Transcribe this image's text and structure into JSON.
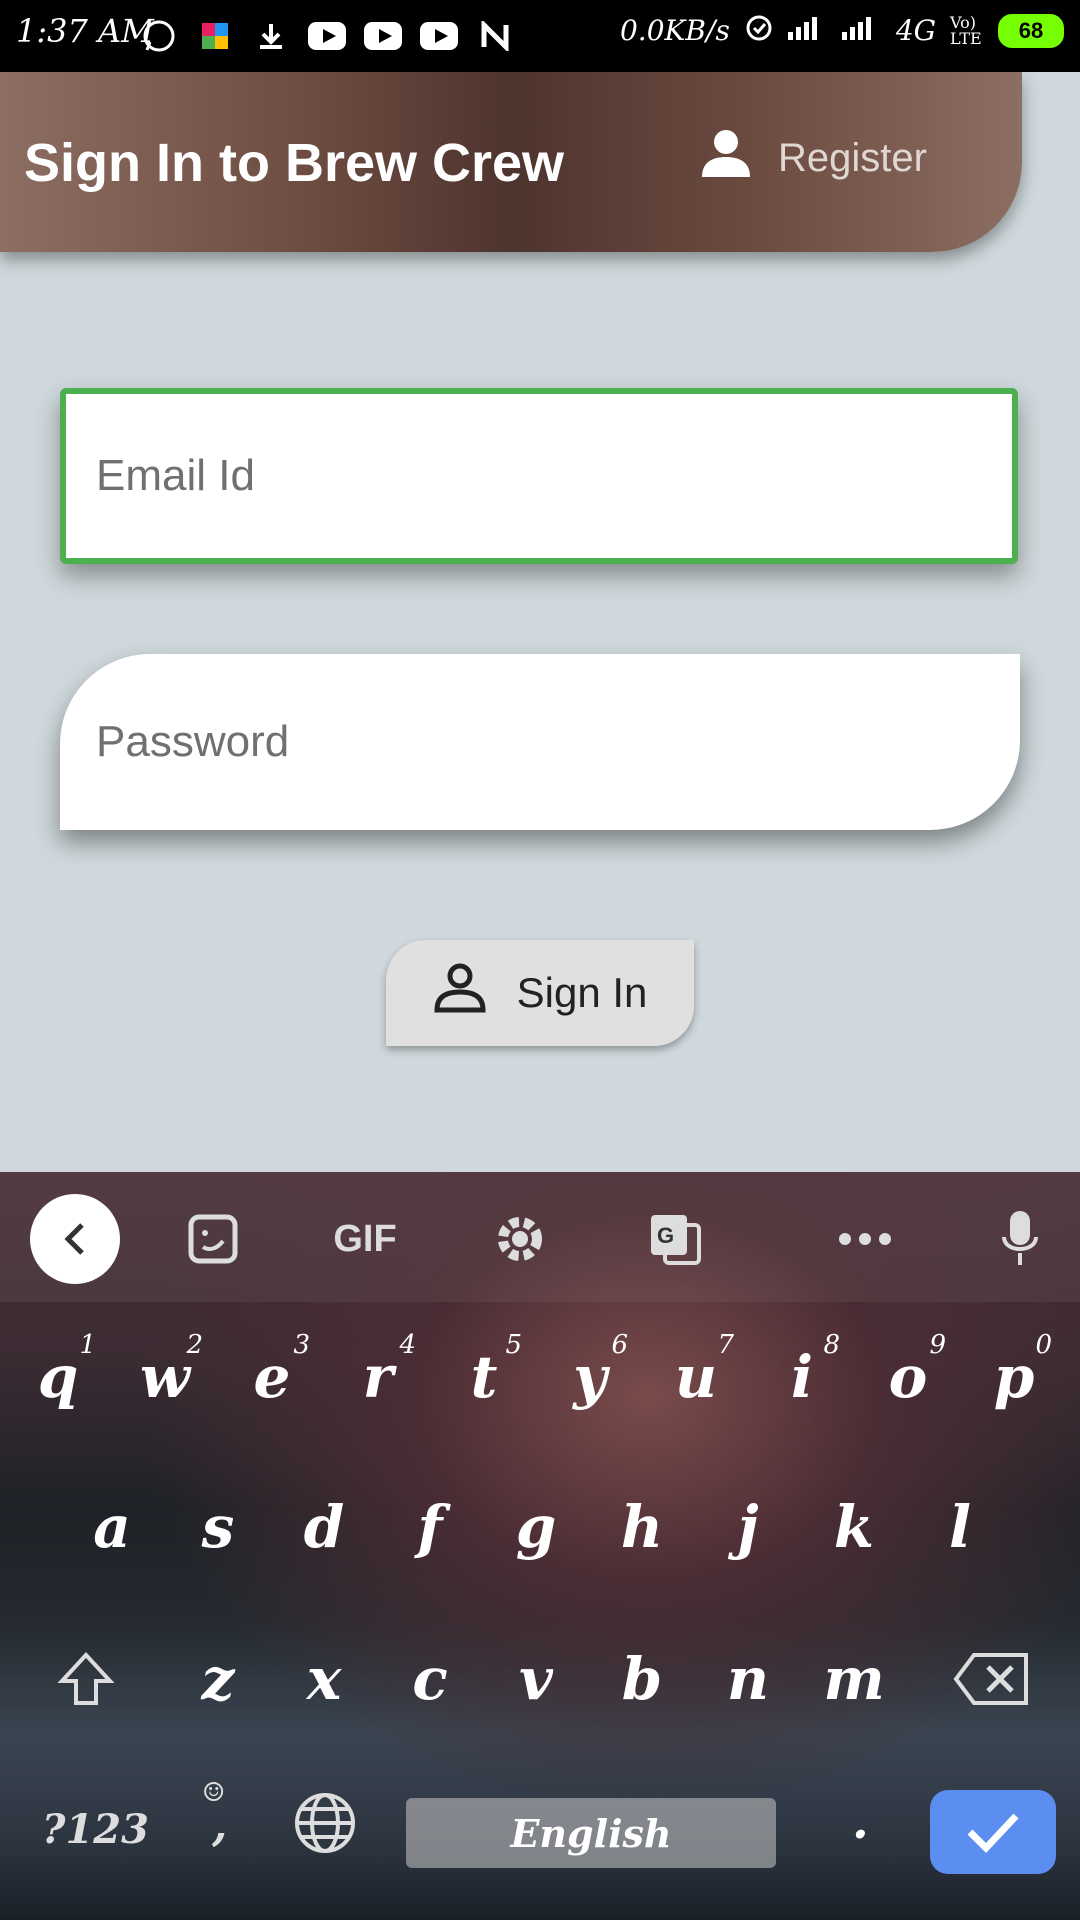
{
  "status_bar": {
    "time": "1:37 AM",
    "net_speed": "0.0KB/s",
    "network": "4G",
    "volte": "Vo) LTE",
    "battery": "68"
  },
  "app_bar": {
    "title": "Sign In to Brew Crew",
    "register_label": "Register"
  },
  "form": {
    "email_placeholder": "Email Id",
    "password_placeholder": "Password",
    "signin_label": "Sign In"
  },
  "keyboard": {
    "gif_label": "GIF",
    "row1": [
      "q",
      "w",
      "e",
      "r",
      "t",
      "y",
      "u",
      "i",
      "o",
      "p"
    ],
    "row1_hints": [
      "1",
      "2",
      "3",
      "4",
      "5",
      "6",
      "7",
      "8",
      "9",
      "0"
    ],
    "row2": [
      "a",
      "s",
      "d",
      "f",
      "g",
      "h",
      "j",
      "k",
      "l"
    ],
    "row3": [
      "z",
      "x",
      "c",
      "v",
      "b",
      "n",
      "m"
    ],
    "symbols_label": "?123",
    "comma_label": ",",
    "period_label": ".",
    "space_label": "English"
  },
  "colors": {
    "accent_green": "#4caf50",
    "appbar_brown": "#6d4c41",
    "enter_blue": "#5b8ef0"
  }
}
